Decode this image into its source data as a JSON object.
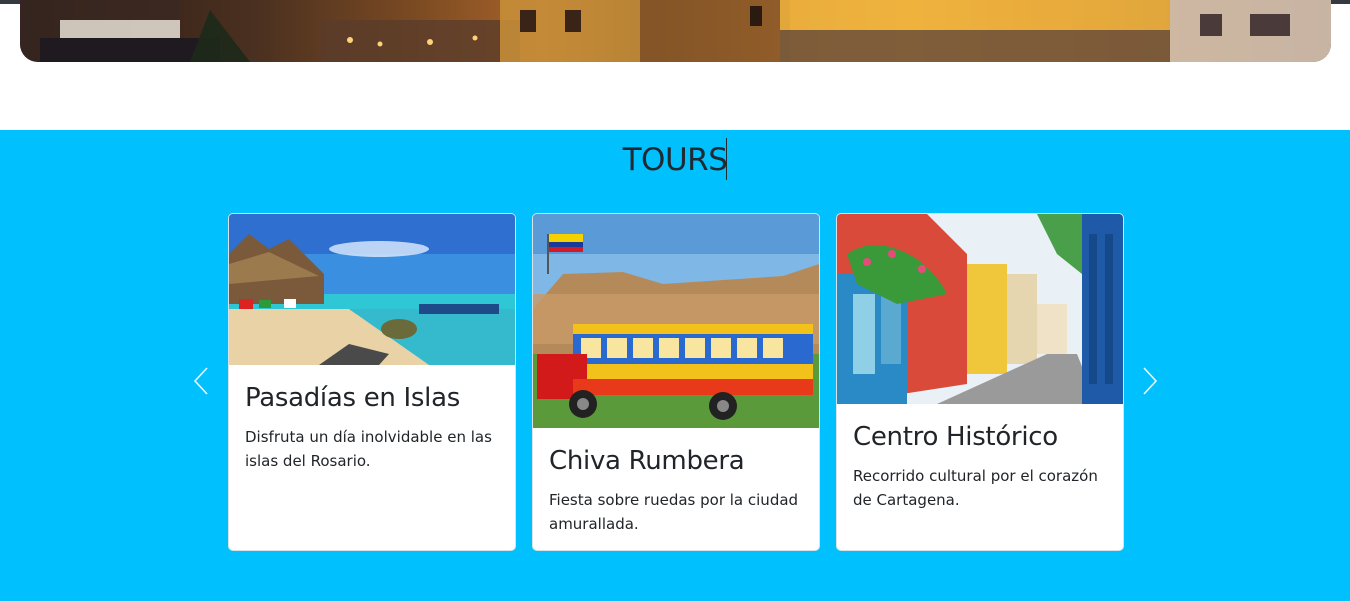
{
  "colors": {
    "section_bg": "#00c0fe",
    "card_bg": "#ffffff",
    "text": "#212529"
  },
  "hero": {
    "image": "night-harbor-cityscape-photo"
  },
  "tours": {
    "title": "TOURS",
    "prev_icon": "chevron-left-icon",
    "next_icon": "chevron-right-icon",
    "cards": [
      {
        "title": "Pasadías en Islas",
        "text": "Disfruta un día inolvidable en las islas del Rosario.",
        "image": "island-beach-photo"
      },
      {
        "title": "Chiva Rumbera",
        "text": "Fiesta sobre ruedas por la ciudad amurallada.",
        "image": "chiva-bus-photo"
      },
      {
        "title": "Centro Histórico",
        "text": "Recorrido cultural por el corazón de Cartagena.",
        "image": "colonial-street-photo"
      }
    ]
  }
}
